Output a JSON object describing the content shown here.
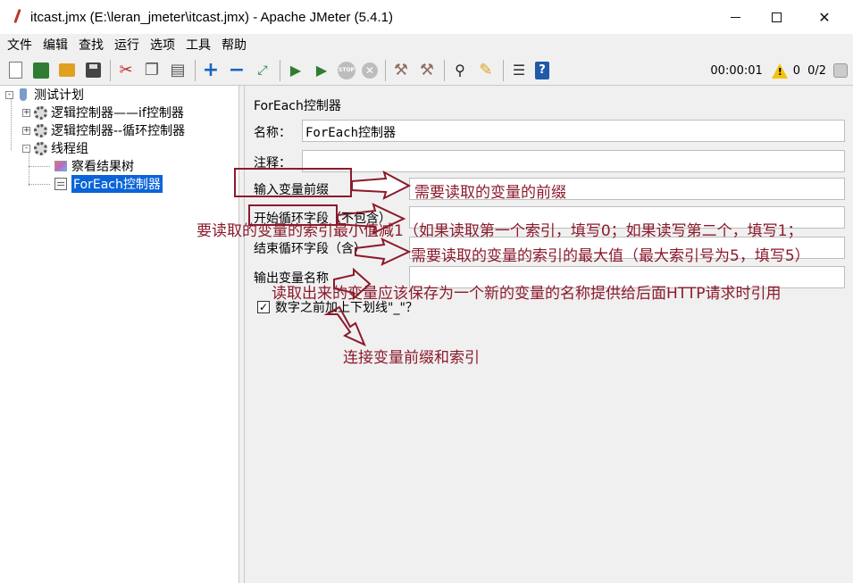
{
  "window": {
    "title": "itcast.jmx (E:\\leran_jmeter\\itcast.jmx) - Apache JMeter (5.4.1)"
  },
  "menubar": {
    "items": [
      "文件",
      "编辑",
      "查找",
      "运行",
      "选项",
      "工具",
      "帮助"
    ]
  },
  "toolbar": {
    "timer": "00:00:01",
    "warnings": "0",
    "threads": "0/2"
  },
  "tree": {
    "nodes": [
      {
        "label": "测试计划",
        "icon": "test-plan-icon",
        "level": 0,
        "expander": "-"
      },
      {
        "label": "逻辑控制器——if控制器",
        "icon": "gear-icon",
        "level": 1,
        "expander": "+"
      },
      {
        "label": "逻辑控制器--循环控制器",
        "icon": "gear-icon",
        "level": 1,
        "expander": "+"
      },
      {
        "label": "线程组",
        "icon": "gear-icon",
        "level": 1,
        "expander": "-"
      },
      {
        "label": "察看结果树",
        "icon": "results-tree-icon",
        "level": 2,
        "expander": ""
      },
      {
        "label": "ForEach控制器",
        "icon": "foreach-icon",
        "level": 2,
        "expander": "",
        "selected": true
      }
    ]
  },
  "panel": {
    "title": "ForEach控制器",
    "name_label": "名称：",
    "name_value": "ForEach控制器",
    "comment_label": "注释：",
    "comment_value": "",
    "input_prefix_label": "输入变量前缀",
    "input_prefix_value": "",
    "start_index_label": "开始循环字段（不包含）",
    "start_index_value": "",
    "end_index_label": "结束循环字段（含）",
    "end_index_value": "",
    "output_var_label": "输出变量名称",
    "output_var_value": "",
    "separator_label": "数字之前加上下划线\"_\"？",
    "separator_checked": true
  },
  "annotations": {
    "input_prefix": "需要读取的变量的前缀",
    "start_index": "要读取的变量的索引最小值减1（如果读取第一个索引，填写0；如果读写第二个，填写1；",
    "end_index": "需要读取的变量的索引的最大值（最大索引号为5，填写5）",
    "output_var": "读取出来的变量应该保存为一个新的变量的名称提供给后面HTTP请求时引用",
    "separator": "连接变量前缀和索引"
  },
  "colors": {
    "annotation": "#8b1a2b",
    "selection": "#0a64d8"
  }
}
